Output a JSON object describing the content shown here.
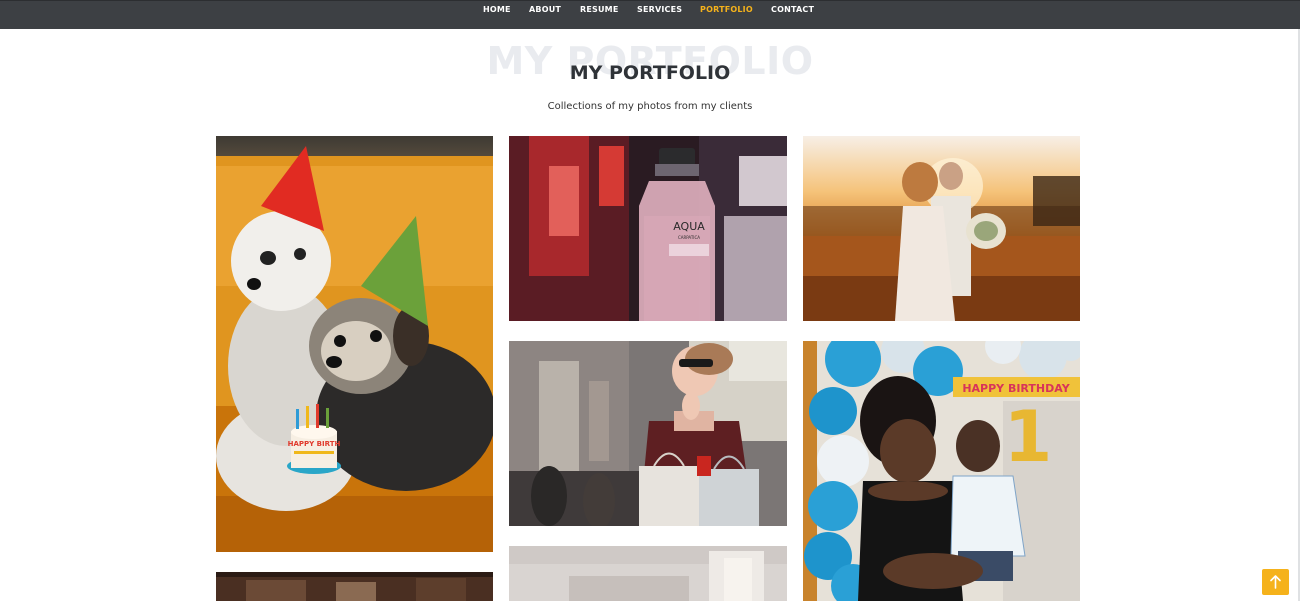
{
  "nav": {
    "items": [
      {
        "label": "HOME"
      },
      {
        "label": "ABOUT"
      },
      {
        "label": "RESUME"
      },
      {
        "label": "SERVICES"
      },
      {
        "label": "PORTFOLIO",
        "active": true
      },
      {
        "label": "CONTACT"
      }
    ],
    "background": "#3d4044",
    "active_color": "#f5b21b"
  },
  "portfolio": {
    "ghost_title": "MY PORTFOLIO",
    "title": "MY PORTFOLIO",
    "subtitle": "Collections of my photos from my clients",
    "items": [
      {
        "subject": "two dogs in party hats with birthday cake"
      },
      {
        "subject": "aqua carpatica water bottle"
      },
      {
        "subject": "wedding couple in golden field"
      },
      {
        "subject": "woman with shopping bags"
      },
      {
        "subject": "girl holding baby at birthday party"
      },
      {
        "subject": "interior room"
      },
      {
        "subject": "kitchen table"
      }
    ],
    "bottle_label": "AQUA",
    "bottle_sublabel": "CARPATICA",
    "banner_text": "HAPPY BIRTHDAY",
    "cake_text": "HAPPY BIRTH",
    "balloon_number": "1"
  },
  "back_to_top": {
    "icon": "arrow-up-icon",
    "color": "#f5b21b"
  }
}
